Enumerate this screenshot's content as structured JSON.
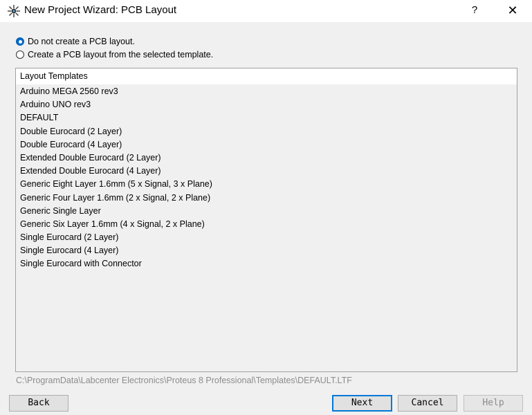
{
  "window": {
    "title": "New Project Wizard: PCB Layout",
    "help_label": "?",
    "close_label": "✕"
  },
  "options": {
    "no_pcb": {
      "label": "Do not create a PCB layout.",
      "checked": true
    },
    "from_template": {
      "label": "Create a PCB layout from the selected template.",
      "checked": false
    }
  },
  "templates": {
    "header": "Layout Templates",
    "items": [
      "Arduino MEGA 2560 rev3",
      "Arduino UNO rev3",
      "DEFAULT",
      "Double Eurocard (2 Layer)",
      "Double Eurocard (4 Layer)",
      "Extended Double Eurocard (2 Layer)",
      "Extended Double Eurocard (4 Layer)",
      "Generic Eight Layer 1.6mm (5 x Signal, 3 x Plane)",
      "Generic Four Layer 1.6mm (2 x Signal, 2 x Plane)",
      "Generic Single Layer",
      "Generic Six Layer 1.6mm (4 x Signal, 2 x Plane)",
      "Single Eurocard (2 Layer)",
      "Single Eurocard (4 Layer)",
      "Single Eurocard with Connector"
    ]
  },
  "template_path": "C:\\ProgramData\\Labcenter Electronics\\Proteus 8 Professional\\Templates\\DEFAULT.LTF",
  "buttons": {
    "back": "Back",
    "next": "Next",
    "cancel": "Cancel",
    "help": "Help"
  },
  "colors": {
    "accent": "#0067c0",
    "disabled_text": "#8c8c8c"
  }
}
